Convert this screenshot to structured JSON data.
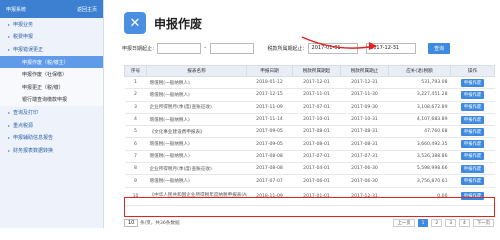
{
  "sidebar": {
    "header_left": "申报系统",
    "header_right": "返回主页",
    "items": [
      {
        "label": "申报业务",
        "sub": false,
        "active": false
      },
      {
        "label": "税费申报",
        "sub": false,
        "active": false
      },
      {
        "label": "申报错误更正",
        "sub": false,
        "active": false
      },
      {
        "label": "申报作废（税/缴主）",
        "sub": true,
        "active": true
      },
      {
        "label": "申报作废（社保缴）",
        "sub": true,
        "active": false
      },
      {
        "label": "申报更正（税/缴）",
        "sub": true,
        "active": false
      },
      {
        "label": "银行端查询缴款申报",
        "sub": true,
        "active": false
      },
      {
        "label": "查询及打印",
        "sub": false,
        "active": false
      },
      {
        "label": "重点税源",
        "sub": false,
        "active": false
      },
      {
        "label": "申报辅助信息报告",
        "sub": false,
        "active": false
      },
      {
        "label": "财务报表数据转换",
        "sub": false,
        "active": false
      }
    ]
  },
  "header": {
    "title": "申报作废",
    "logo_glyph": "✕"
  },
  "filter": {
    "date_label": "申报日期起止：",
    "date_from": "",
    "date_to": "",
    "period_label": "税款所属期起止：",
    "period_from": "2017-01-01",
    "period_to": "2017-12-31",
    "search_label": "查询"
  },
  "table": {
    "headers": [
      "序号",
      "报表名称",
      "申报日期",
      "税款所属期起",
      "税款所属期止",
      "应补(退)税额",
      "操作"
    ],
    "rows": [
      {
        "no": "1",
        "name": "增值税(一般纳税人)",
        "date": "2018-01-12",
        "from": "2017-12-01",
        "to": "2017-12-31",
        "amount": "531,793.08",
        "op": "申报作废"
      },
      {
        "no": "2",
        "name": "增值税(一般纳税人)",
        "date": "2017-12-15",
        "from": "2017-11-01",
        "to": "2017-11-30",
        "amount": "3,227,451.28",
        "op": "申报作废"
      },
      {
        "no": "3",
        "name": "企业所得税月(季)度(查账征收)",
        "date": "2017-11-09",
        "from": "2017-07-01",
        "to": "2017-09-30",
        "amount": "3,108,672.89",
        "op": "申报作废"
      },
      {
        "no": "4",
        "name": "增值税(一般纳税人)",
        "date": "2017-11-14",
        "from": "2017-10-01",
        "to": "2017-10-31",
        "amount": "4,107,683.89",
        "op": "申报作废"
      },
      {
        "no": "5",
        "name": "《文化事业建设费申报表》",
        "date": "2017-09-05",
        "from": "2017-08-01",
        "to": "2017-08-31",
        "amount": "47,760.68",
        "op": "申报作废"
      },
      {
        "no": "6",
        "name": "增值税(一般纳税人)",
        "date": "2017-09-05",
        "from": "2017-08-01",
        "to": "2017-08-31",
        "amount": "3,660,492.35",
        "op": "申报作废"
      },
      {
        "no": "7",
        "name": "增值税(一般纳税人)",
        "date": "2017-08-08",
        "from": "2017-07-01",
        "to": "2017-07-31",
        "amount": "3,526,388.86",
        "op": "申报作废"
      },
      {
        "no": "8",
        "name": "企业所得税月(季)度(查账征收)",
        "date": "2017-08-08",
        "from": "2017-04-01",
        "to": "2017-06-30",
        "amount": "5,598,998.66",
        "op": "申报作废"
      },
      {
        "no": "9",
        "name": "增值税(一般纳税人)",
        "date": "2017-07-07",
        "from": "2017-06-01",
        "to": "2017-06-30",
        "amount": "3,756,870.61",
        "op": "申报作废"
      },
      {
        "no": "10",
        "name": "《中华人民共和国企业所得税年度纳税申报表(A类)》(2017)",
        "date": "2018-11-09",
        "from": "2017-01-01",
        "to": "2017-12-31",
        "amount": "0.00",
        "op": "申报作废"
      }
    ]
  },
  "pager": {
    "summary": "条/页，共36条数据",
    "per_page": "10",
    "prev": "上一页",
    "p1": "1",
    "p2": "2",
    "p3": "3",
    "p4": "4",
    "next": "下一页"
  }
}
